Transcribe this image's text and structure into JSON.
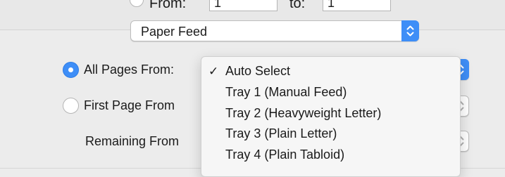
{
  "range": {
    "from_label": "From:",
    "to_label": "to:",
    "from_value": "1",
    "to_value": "1"
  },
  "section_popup": {
    "value": "Paper Feed"
  },
  "options": {
    "all_pages_label": "All Pages From:",
    "first_page_label": "First Page From",
    "remaining_label": "Remaining From"
  },
  "tray_menu": {
    "items": [
      {
        "label": "Auto Select",
        "checked": true,
        "check": "✓"
      },
      {
        "label": "Tray 1 (Manual Feed)"
      },
      {
        "label": "Tray 2 (Heavyweight Letter)"
      },
      {
        "label": "Tray 3 (Plain Letter)"
      },
      {
        "label": "Tray 4 (Plain Tabloid)"
      }
    ]
  },
  "colors": {
    "accent": "#3e8ef7",
    "background": "#ececec"
  }
}
